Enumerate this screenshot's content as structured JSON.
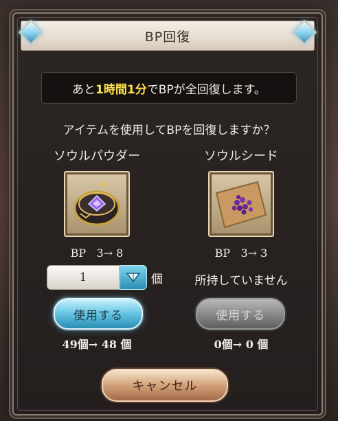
{
  "dialog": {
    "title": "BP回復",
    "notice": {
      "prefix": "あと",
      "time": "1時間1分",
      "suffix": "でBPが全回復します。"
    },
    "question": "アイテムを使用してBPを回復しますか？"
  },
  "items": [
    {
      "name": "ソウルパウダー",
      "bp_label": "BP",
      "bp_change": "3→ 8",
      "quantity": "1",
      "quantity_unit": "個",
      "use_label": "使用する",
      "count_change": "49個→ 48 個",
      "icon": "soul-powder-icon"
    },
    {
      "name": "ソウルシード",
      "bp_label": "BP",
      "bp_change": "3→ 3",
      "status": "所持していません",
      "use_label": "使用する",
      "count_change": "0個→ 0 個",
      "icon": "soul-seed-icon"
    }
  ],
  "cancel_label": "キャンセル",
  "colors": {
    "highlight": "#ffe14d",
    "use_button": "#6cc8e6",
    "disabled_button": "#8a8a8a",
    "cancel_button": "#d2a27a"
  }
}
